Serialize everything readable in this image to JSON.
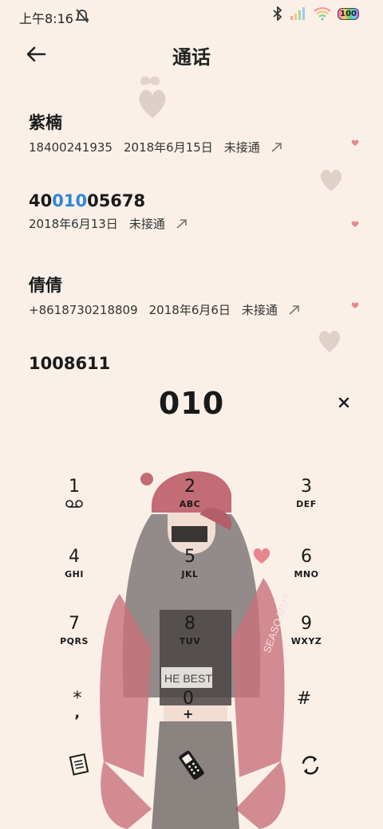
{
  "status_bar": {
    "time": "上午8:16",
    "battery": "100"
  },
  "header": {
    "title": "通话"
  },
  "calls": [
    {
      "name": "紫楠",
      "name_parts": [
        "紫楠"
      ],
      "number": "18400241935",
      "date": "2018年6月15日",
      "status": "未接通"
    },
    {
      "name": "4001005678",
      "name_parts": [
        "40",
        "010",
        "05678"
      ],
      "number": "",
      "date": "2018年6月13日",
      "status": "未接通"
    },
    {
      "name": "倩倩",
      "name_parts": [
        "倩倩"
      ],
      "number": "+8618730218809",
      "date": "2018年6月6日",
      "status": "未接通"
    },
    {
      "name": "1008611",
      "name_parts": [
        "1008611"
      ],
      "number": "",
      "date": "",
      "status": ""
    }
  ],
  "dialer": {
    "input_value": "010"
  },
  "keypad": [
    {
      "digit": "1",
      "letters": "",
      "icon": "voicemail-icon"
    },
    {
      "digit": "2",
      "letters": "ABC"
    },
    {
      "digit": "3",
      "letters": "DEF"
    },
    {
      "digit": "4",
      "letters": "GHI"
    },
    {
      "digit": "5",
      "letters": "JKL"
    },
    {
      "digit": "6",
      "letters": "MNO"
    },
    {
      "digit": "7",
      "letters": "PQRS"
    },
    {
      "digit": "8",
      "letters": "TUV"
    },
    {
      "digit": "9",
      "letters": "WXYZ"
    },
    {
      "digit": "*",
      "letters": ","
    },
    {
      "digit": "0",
      "letters": "+"
    },
    {
      "digit": "#",
      "letters": ""
    }
  ],
  "illustration_text": {
    "shirt": "HE BEST",
    "sleeve": "SEASO MMX"
  },
  "colors": {
    "background": "#faf0e8",
    "highlight": "#2f86d8",
    "heart": "#e8868e",
    "jacket": "#c8727a"
  }
}
